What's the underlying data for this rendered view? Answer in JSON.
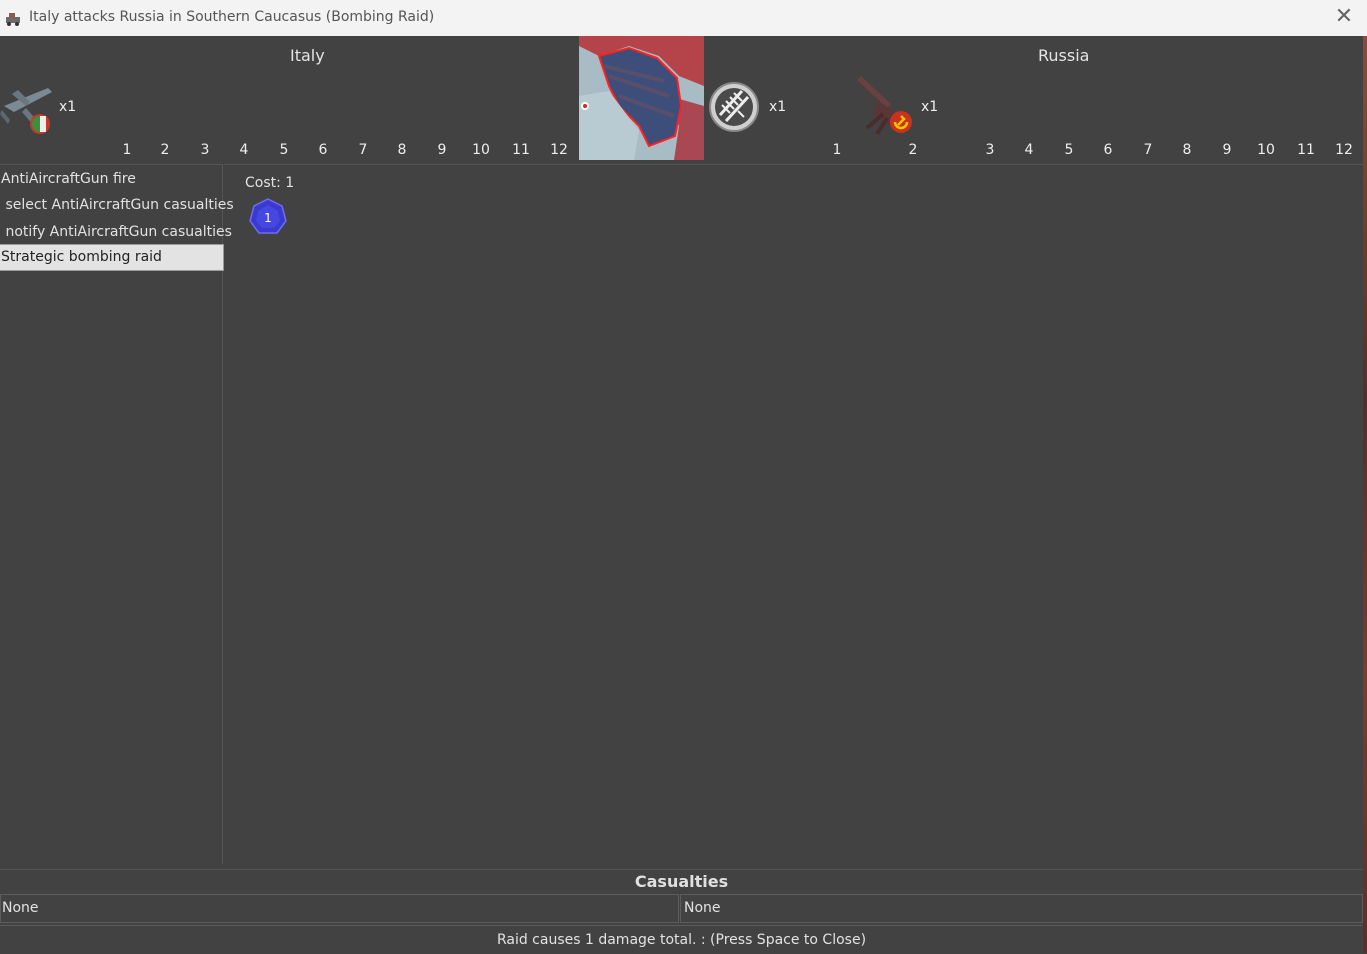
{
  "window": {
    "title": "Italy attacks Russia in Southern Caucasus  (Bombing Raid)"
  },
  "attacker": {
    "name": "Italy",
    "units": [
      {
        "icon": "bomber-plane-icon",
        "count": "x1"
      }
    ],
    "dice_numbers": [
      "1",
      "2",
      "3",
      "4",
      "5",
      "6",
      "7",
      "8",
      "9",
      "10",
      "11",
      "12"
    ]
  },
  "defender": {
    "name": "Russia",
    "units": [
      {
        "icon": "railway-target-icon",
        "count": "x1"
      },
      {
        "icon": "antiaircraft-gun-icon",
        "count": "x1"
      }
    ],
    "dice_numbers": [
      "1",
      "2",
      "3",
      "4",
      "5",
      "6",
      "7",
      "8",
      "9",
      "10",
      "11",
      "12"
    ]
  },
  "steps": [
    {
      "label": "AntiAircraftGun fire",
      "selected": false
    },
    {
      "label": " select AntiAircraftGun casualties",
      "selected": false
    },
    {
      "label": " notify AntiAircraftGun casualties",
      "selected": false
    },
    {
      "label": "Strategic bombing raid",
      "selected": true
    }
  ],
  "action": {
    "cost_label": "Cost: 1",
    "die_value": "1",
    "die_color": "#3a3ad0"
  },
  "casualties": {
    "header": "Casualties",
    "attacker": "None",
    "defender": "None"
  },
  "status": "Raid causes 1 damage total. : (Press Space to Close)"
}
